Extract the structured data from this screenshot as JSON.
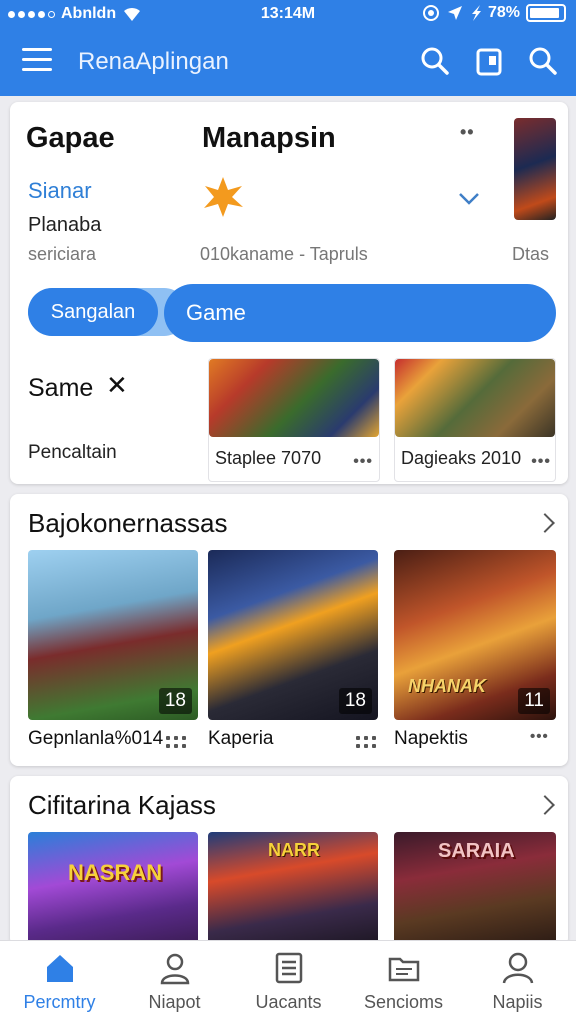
{
  "status_bar": {
    "carrier": "Abnldn",
    "time": "13:14M",
    "battery": "78%"
  },
  "app_bar": {
    "title": "RenaAplingan"
  },
  "featured": {
    "heading_left": "Gapae",
    "heading_mid": "Manapsin",
    "link": "Sianar",
    "label": "Planaba",
    "sub_left": "sericiara",
    "sub_mid": "010kaname - Tapruls",
    "sub_right": "Dtas",
    "pill_primary": "Sangalan",
    "pill_secondary": "Game",
    "search_term": "Same",
    "clear_glyph": "✕",
    "caption": "Pencaltain",
    "games": [
      {
        "label": "Staplee 7070"
      },
      {
        "label": "Dagieaks 2010"
      }
    ]
  },
  "section_one": {
    "title": "Bajokonernassas",
    "tiles": [
      {
        "label": "Gepnlanla%014",
        "badge": "18",
        "overlay": ""
      },
      {
        "label": "Kaperia",
        "badge": "18",
        "overlay": ""
      },
      {
        "label": "Napektis",
        "badge": "11",
        "overlay": "NHANAK"
      }
    ]
  },
  "section_two": {
    "title": "Cifitarina Kajass",
    "tiles": [
      {
        "overlay": "NASRAN"
      },
      {
        "overlay": "NARR"
      },
      {
        "overlay": "SARAIA"
      }
    ]
  },
  "bottom_nav": [
    {
      "label": "Percmtry",
      "icon": "home-icon"
    },
    {
      "label": "Niapot",
      "icon": "person-icon"
    },
    {
      "label": "Uacants",
      "icon": "document-icon"
    },
    {
      "label": "Sencioms",
      "icon": "folder-icon"
    },
    {
      "label": "Napiis",
      "icon": "profile-icon"
    }
  ],
  "colors": {
    "primary": "#2f80e6",
    "link": "#2f7fd6",
    "background": "#ececf0"
  }
}
